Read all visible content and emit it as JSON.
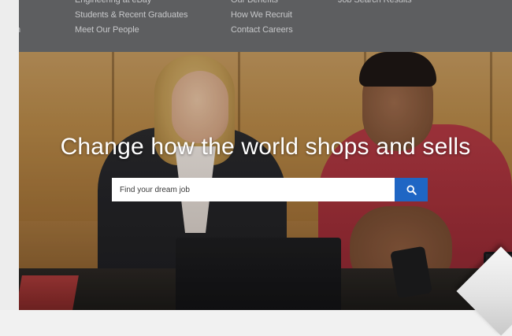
{
  "nav": {
    "col_a": [
      "ry",
      "on"
    ],
    "col_b": [
      "Engineering at eBay",
      "Students & Recent Graduates",
      "Meet Our People"
    ],
    "col_c": [
      "Our Benefits",
      "How We Recruit",
      "Contact Careers"
    ],
    "col_d": [
      "Job Search Results"
    ]
  },
  "hero": {
    "headline": "Change how the world shops and sells",
    "search": {
      "placeholder": "Find your dream job",
      "button_icon": "search-icon"
    }
  },
  "colors": {
    "nav_background": "#5d5e60",
    "nav_link": "#c6c7c9",
    "search_button": "#1f66c4",
    "headline": "#ffffff"
  }
}
